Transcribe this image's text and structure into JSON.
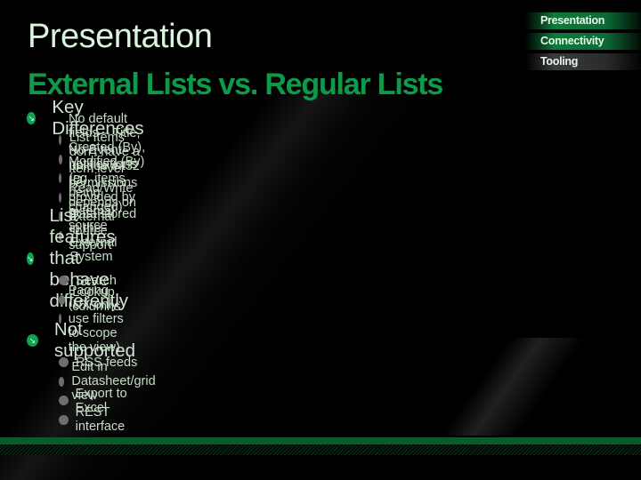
{
  "slide": {
    "title": "Presentation",
    "subtitle": "External Lists vs. Regular Lists"
  },
  "nav": {
    "items": [
      {
        "label": "Presentation",
        "style": "green"
      },
      {
        "label": "Connectivity",
        "style": "green"
      },
      {
        "label": "Tooling",
        "style": "grey"
      }
    ]
  },
  "sections": [
    {
      "label": "Key Differences",
      "items": [
        "No default fields – Title, Created (By), Modified (By)",
        "List Items don’t have a unique int32 ID",
        "No Event notifications (eg. items being changed)",
        "Item level permissions provided by external source",
        "Read/Write depends on external source support",
        "Data stored in the External System"
      ]
    },
    {
      "label": "List features that behave differently",
      "items": [
        "Search",
        "Lookup columns",
        "Paging (UX only; use filters to scope the view)"
      ]
    },
    {
      "label": "Not supported",
      "items": [
        "RSS feeds",
        "Edit in Datasheet/grid view",
        "Export to Excel",
        "REST interface"
      ]
    }
  ],
  "icons": {
    "section_bullet": "↘",
    "section_bullet_name": "arrow-bullet-icon"
  },
  "colors": {
    "accent_green": "#0f9a4a",
    "title_light": "#d9f5dd",
    "background": "#000000"
  }
}
